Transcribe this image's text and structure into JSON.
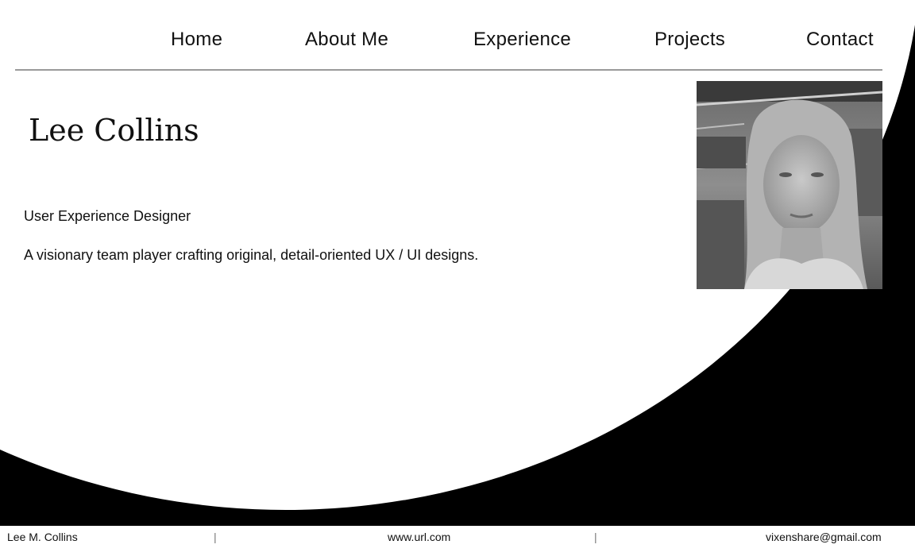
{
  "nav": {
    "items": [
      {
        "label": "Home"
      },
      {
        "label": "About Me"
      },
      {
        "label": "Experience"
      },
      {
        "label": "Projects"
      },
      {
        "label": "Contact"
      }
    ]
  },
  "hero": {
    "name": "Lee Collins",
    "role": "User Experience Designer",
    "tagline": "A visionary team player crafting original, detail-oriented UX / UI designs."
  },
  "footer": {
    "name": "Lee M. Collins",
    "separator": "|",
    "website": "www.url.com",
    "email": "vixenshare@gmail.com"
  },
  "colors": {
    "background": "#ffffff",
    "accent_shape": "#000000",
    "text": "#111111",
    "divider": "#9a9a9a"
  }
}
